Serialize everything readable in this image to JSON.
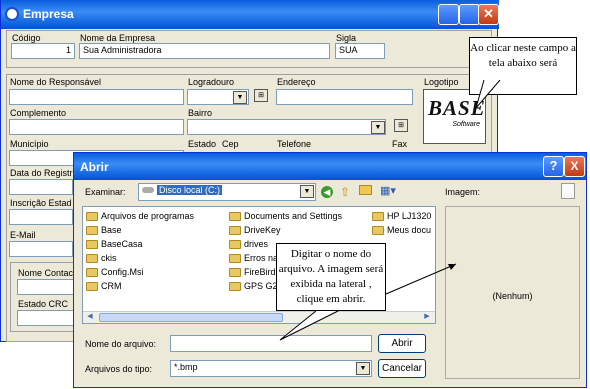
{
  "empresa": {
    "title": "Empresa",
    "codigo_label": "Código",
    "codigo_value": "1",
    "nome_label": "Nome da Empresa",
    "nome_value": "Sua Administradora",
    "sigla_label": "Sigla",
    "sigla_value": "SUA",
    "responsavel_label": "Nome do Responsável",
    "logradouro_label": "Logradouro",
    "endereco_label": "Endereço",
    "logotipo_label": "Logotipo",
    "complemento_label": "Complemento",
    "bairro_label": "Bairro",
    "municipio_label": "Município",
    "estado_label": "Estado",
    "cep_label": "Cep",
    "telefone_label": "Telefone",
    "fax_label": "Fax",
    "data_registro_label": "Data do Registr",
    "inscricao_label": "Inscrição Estad",
    "email_label": "E-Mail",
    "nome_contato_label": "Nome Contac",
    "estado_crc_label": "Estado CRC",
    "logo_text": "BASE",
    "logo_sub": "Software"
  },
  "abrir": {
    "title": "Abrir",
    "examinar_label": "Examinar:",
    "location": "Disco local (C:)",
    "imagem_label": "Imagem:",
    "preview_text": "(Nenhum)",
    "files": [
      "Arquivos de programas",
      "Base",
      "BaseCasa",
      "ckis",
      "Config.Msi",
      "CRM",
      "Documents and Settings",
      "DriveKey",
      "drives",
      "Erros na",
      "FireBird",
      "GPS G28",
      "HP LJ1320",
      "Meus docu"
    ],
    "nome_arquivo_label": "Nome do arquivo:",
    "tipo_label": "Arquivos do tipo:",
    "tipo_value": "*.bmp",
    "abrir_button": "Abrir",
    "cancelar_button": "Cancelar",
    "help": "?",
    "close": "X"
  },
  "notes": {
    "top": "Ao clicar neste campo a tela abaixo será",
    "mid": "Digitar o nome do arquivo. A imagem será exibida na lateral , clique em abrir."
  }
}
